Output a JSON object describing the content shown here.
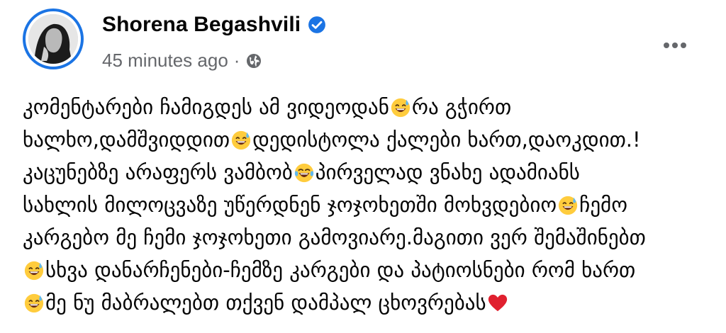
{
  "post": {
    "author": "Shorena Begashvili",
    "timestamp": "45 minutes ago",
    "separator": "·",
    "audience_icon": "globe-icon",
    "verified_icon": "verified-badge-icon",
    "more_icon": "more-options-icon",
    "verified_color": "#1b74e4",
    "text_lines": [
      [
        "კომენტარები ჩამიგდეს ამ ვიდეოდან",
        "😅",
        "რა გჭირთ"
      ],
      [
        "ხალხო,დამშვიდდით",
        "😅",
        "დედისტოლა ქალები ხართ,დაოკდით.!"
      ],
      [
        "კაცუნებზე არაფერს ვამბობ",
        "😂",
        "პირველად ვნახე ადამიანს"
      ],
      [
        "სახლის მილოცვაზე უწერდნენ ჯოჯოხეთში მოხვდებიო",
        "😅",
        "ჩემო"
      ],
      [
        "კარგებო მე ჩემი ჯოჯოხეთი გამოვიარე.მაგითი ვერ შემაშინებთ"
      ],
      [
        "😅",
        "სხვა დანარჩენები-ჩემზე კარგები და პატიოსნები რომ ხართ"
      ],
      [
        "😅",
        "მე ნუ მაბრალებთ თქვენ დამპალ ცხოვრებას",
        "❤️"
      ]
    ]
  }
}
